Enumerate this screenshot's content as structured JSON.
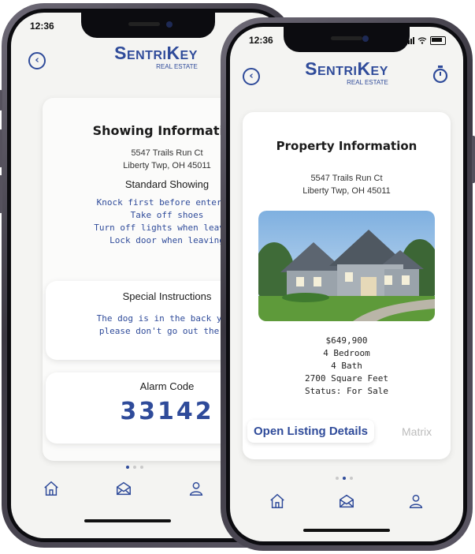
{
  "back_phone": {
    "status_time": "12:36",
    "brand": "SentriKey",
    "brand_sub": "REAL ESTATE",
    "heading": "Showing Information",
    "address_line1": "5547 Trails Run Ct",
    "address_line2": "Liberty Twp, OH 45011",
    "subheading": "Standard Showing",
    "instructions": [
      "Knock first before entering",
      "Take off shoes",
      "Turn off lights when leaving",
      "Lock door when leaving"
    ],
    "special_heading": "Special Instructions",
    "special_text_line1": "The dog is in the back yard",
    "special_text_line2": "please don't go out there.",
    "alarm_label": "Alarm Code",
    "alarm_code": "33142"
  },
  "front_phone": {
    "status_time": "12:36",
    "brand": "SentriKey",
    "brand_sub": "REAL ESTATE",
    "heading": "Property Information",
    "address_line1": "5547 Trails Run Ct",
    "address_line2": "Liberty Twp, OH 45011",
    "price": "$649,900",
    "bedrooms": "4 Bedroom",
    "baths": "4 Bath",
    "sqft": "2700 Square Feet",
    "status": "Status: For Sale",
    "open_listing_label": "Open Listing Details",
    "matrix_label": "Matrix"
  },
  "colors": {
    "brand_blue": "#2f4b9a",
    "screen_bg": "#f4f4f2"
  },
  "icons": [
    "back-icon",
    "timer-icon",
    "home-icon",
    "mail-icon",
    "user-icon"
  ]
}
